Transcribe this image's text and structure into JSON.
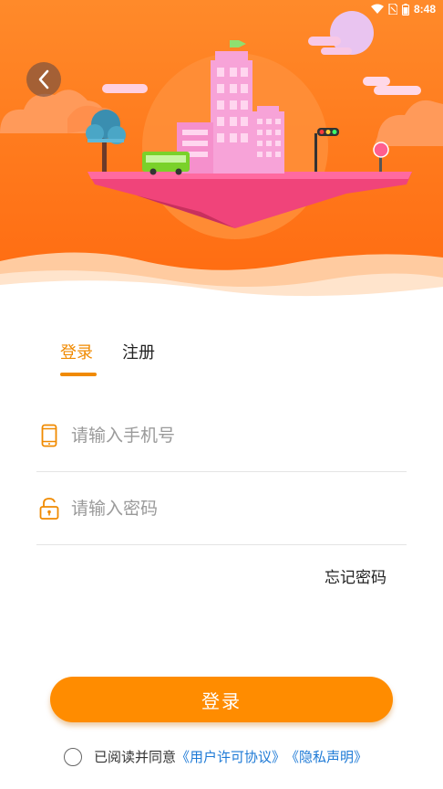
{
  "status": {
    "time": "8:48",
    "icons": [
      "wifi-icon",
      "sim-icon",
      "battery-icon"
    ]
  },
  "header": {
    "back_icon": "chevron-left-icon"
  },
  "tabs": [
    {
      "label": "登录",
      "active": true
    },
    {
      "label": "注册",
      "active": false
    }
  ],
  "form": {
    "phone_placeholder": "请输入手机号",
    "phone_icon": "phone-icon",
    "password_placeholder": "请输入密码",
    "password_icon": "lock-icon"
  },
  "forgot_label": "忘记密码",
  "login_button": "登录",
  "agreement": {
    "prefix": "已阅读并同意",
    "user_license": "《用户许可协议》",
    "privacy": "《隐私声明》",
    "checked": false
  },
  "colors": {
    "accent": "#ff8c00",
    "link": "#1e7ad6",
    "hero_bg": "#ff7a1a"
  }
}
